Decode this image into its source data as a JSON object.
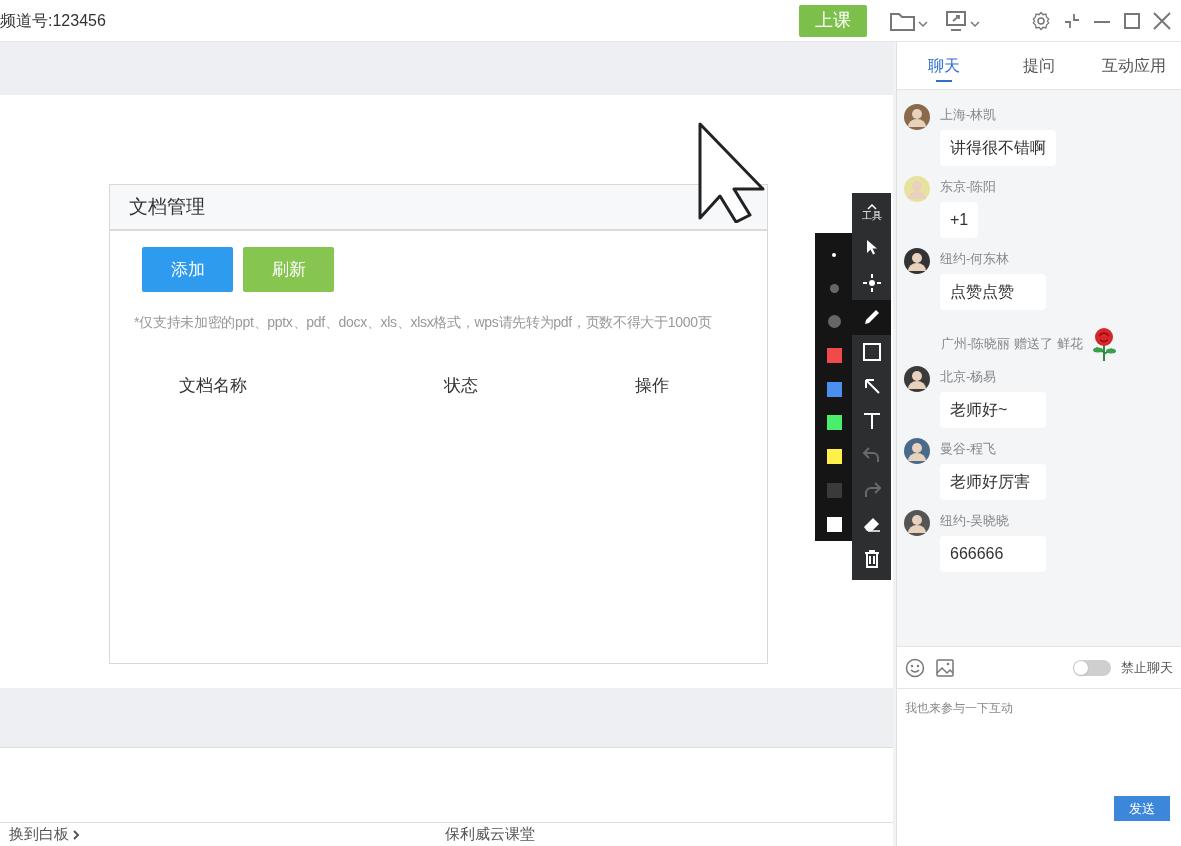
{
  "window": {
    "channel": "频道号:123456",
    "start_button": "上课"
  },
  "dialog": {
    "title": "文档管理",
    "buttons": [
      {
        "label": "添加",
        "kind": "primary"
      },
      {
        "label": "刷新",
        "kind": "secondary"
      }
    ],
    "note": "*仅支持未加密的ppt、pptx、pdf、docx、xls、xlsx格式，wps请先转为pdf，页数不得大于1000页",
    "columns": [
      "文档名称",
      "状态",
      "操作"
    ]
  },
  "toolbar": {
    "label": "工具",
    "tools": [
      {
        "kind": "select",
        "selected": false,
        "disabled": false
      },
      {
        "kind": "move",
        "selected": false,
        "disabled": false
      },
      {
        "kind": "pen",
        "selected": true,
        "disabled": false
      },
      {
        "kind": "rect",
        "selected": false,
        "disabled": false
      },
      {
        "kind": "arrow",
        "selected": false,
        "disabled": false
      },
      {
        "kind": "text",
        "selected": false,
        "disabled": false
      },
      {
        "kind": "undo",
        "selected": false,
        "disabled": true
      },
      {
        "kind": "redo",
        "selected": false,
        "disabled": true
      },
      {
        "kind": "eraser",
        "selected": false,
        "disabled": false
      },
      {
        "kind": "trash",
        "selected": false,
        "disabled": false
      }
    ]
  },
  "palette": {
    "sizes": [
      {
        "kind": "small",
        "selected": true
      },
      {
        "kind": "medium",
        "selected": false
      },
      {
        "kind": "large",
        "selected": false
      }
    ],
    "colors": [
      {
        "color": "#f04a4a"
      },
      {
        "color": "#4a90f0"
      },
      {
        "color": "#4aee6a"
      },
      {
        "color": "#fff04a"
      },
      {
        "color": "#3a3a3a"
      },
      {
        "color": "#ffffff"
      }
    ]
  },
  "footer": {
    "switch_link": "换到白板",
    "brand": "保利威云课堂"
  },
  "chat": {
    "tabs": [
      {
        "label": "聊天",
        "selected": true
      },
      {
        "label": "提问",
        "selected": false
      },
      {
        "label": "互动应用",
        "selected": false
      }
    ],
    "messages": [
      {
        "kind": "message",
        "sender": "上海-林凯",
        "text": "讲得很不错啊"
      },
      {
        "kind": "message",
        "sender": "东京-陈阳",
        "text": "+1"
      },
      {
        "kind": "message",
        "sender": "纽约-何东林",
        "text": "点赞点赞"
      },
      {
        "kind": "gift",
        "sender": "广州-陈晓丽",
        "text": "赠送了 鲜花"
      },
      {
        "kind": "message",
        "sender": "北京-杨易",
        "text": "老师好~"
      },
      {
        "kind": "message",
        "sender": "曼谷-程飞",
        "text": "老师好厉害"
      },
      {
        "kind": "message",
        "sender": "纽约-吴晓晓",
        "text": "666666"
      }
    ],
    "mute_toggle": {
      "label": "禁止聊天",
      "on": false
    },
    "input": {
      "value": "我也来参与一下互动"
    },
    "send_button": "发送"
  }
}
